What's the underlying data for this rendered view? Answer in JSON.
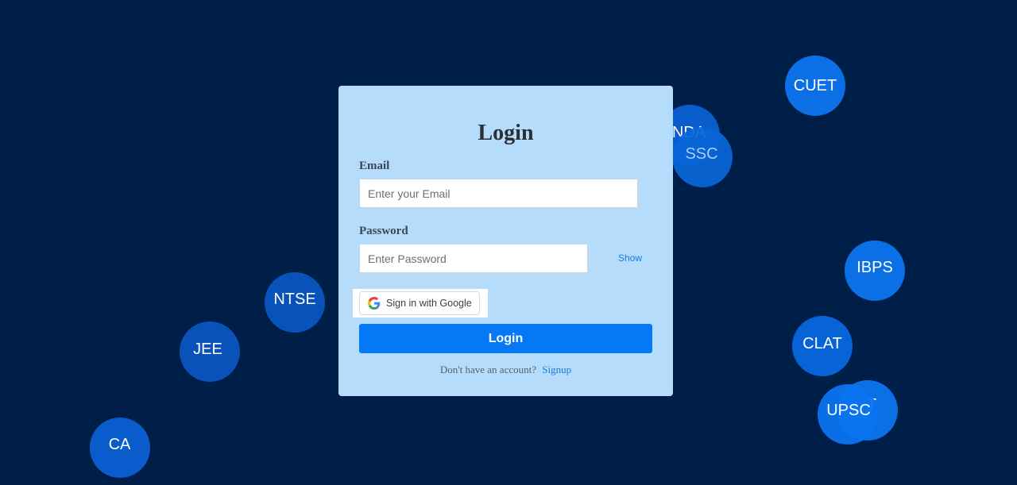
{
  "bubbles": [
    {
      "id": "cuet",
      "label": "CUET",
      "color": "#0b6fe6"
    },
    {
      "id": "nda",
      "label": "NDA",
      "color": "#0a5ccc"
    },
    {
      "id": "ssc",
      "label": "SSC",
      "color": "#0866d8"
    },
    {
      "id": "ibps",
      "label": "IBPS",
      "color": "#0b6fe6"
    },
    {
      "id": "clat",
      "label": "CLAT",
      "color": "#0764d6"
    },
    {
      "id": "upsc",
      "label": "UPSC",
      "color": "#0b74f0"
    },
    {
      "id": "partial",
      "label": "T",
      "color": "#0b6fe6"
    },
    {
      "id": "ntse",
      "label": "NTSE",
      "color": "#0852ba"
    },
    {
      "id": "jee",
      "label": "JEE",
      "color": "#0852ba"
    },
    {
      "id": "ca",
      "label": "CA",
      "color": "#0a5ccc"
    }
  ],
  "login": {
    "title": "Login",
    "email_label": "Email",
    "email_placeholder": "Enter your Email",
    "email_value": "",
    "password_label": "Password",
    "password_placeholder": "Enter Password",
    "password_value": "",
    "show_label": "Show",
    "google_label": "Sign in with Google",
    "login_button": "Login",
    "no_account_text": "Don't have an account?",
    "signup_label": "Signup"
  },
  "colors": {
    "background": "#001f48",
    "card": "#b5ddfb",
    "primary": "#0579f5",
    "link": "#1a7ad9"
  }
}
